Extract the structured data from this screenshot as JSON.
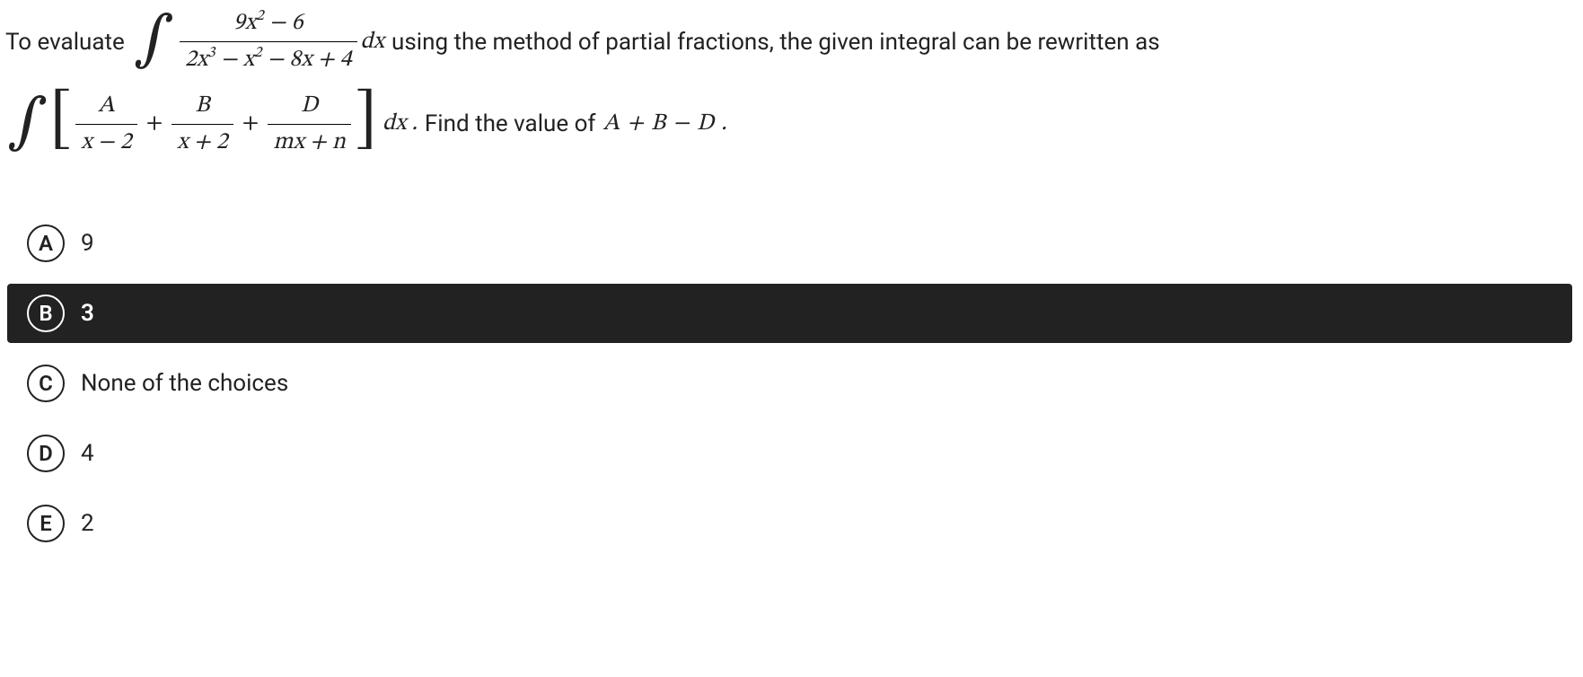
{
  "question": {
    "prefix_1": "To evaluate",
    "integral_1": {
      "numerator": "9x² − 6",
      "denominator": "2x³ − x² − 8x + 4",
      "dx": "dx"
    },
    "middle_1": " using the method of partial fractions, the given integral can be rewritten as",
    "integral_2": {
      "terms": [
        {
          "num": "A",
          "den": "x − 2"
        },
        {
          "num": "B",
          "den": "x + 2"
        },
        {
          "num": "D",
          "den": "mx + n"
        }
      ],
      "dx": "dx ."
    },
    "middle_2": " Find the value of ",
    "expr": "A  +  B  −  D .",
    "plus": "+"
  },
  "choices": [
    {
      "letter": "A",
      "text": "9",
      "selected": false
    },
    {
      "letter": "B",
      "text": "3",
      "selected": true
    },
    {
      "letter": "C",
      "text": "None of the choices",
      "selected": false
    },
    {
      "letter": "D",
      "text": "4",
      "selected": false
    },
    {
      "letter": "E",
      "text": "2",
      "selected": false
    }
  ]
}
